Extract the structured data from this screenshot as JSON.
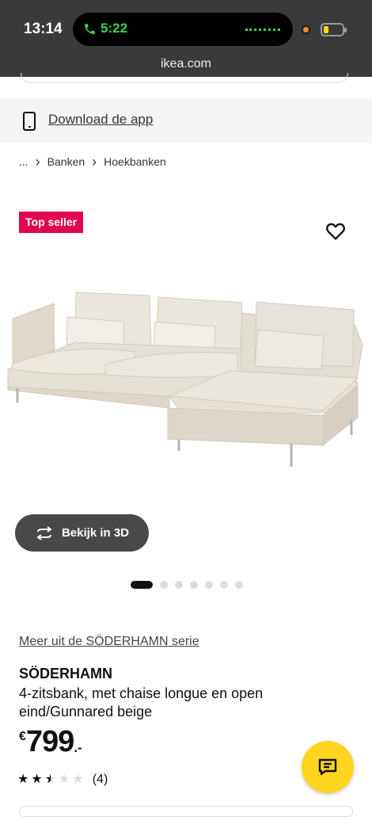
{
  "status_bar": {
    "time": "13:14",
    "call_timer": "5:22",
    "url": "ikea.com"
  },
  "app_banner": {
    "link_text": "Download de app",
    "icon": "phone-icon"
  },
  "breadcrumb": {
    "items": [
      "...",
      "Banken",
      "Hoekbanken"
    ]
  },
  "product": {
    "badge": "Top seller",
    "wishlist_icon": "heart-icon",
    "view_3d_label": "Bekijk in 3D",
    "carousel": {
      "total": 7,
      "active": 1
    },
    "series_link": "Meer uit de SÖDERHAMN serie",
    "name": "SÖDERHAMN",
    "description": "4-zitsbank, met chaise longue en open eind/Gunnared beige",
    "price": {
      "currency": "€",
      "amount": "799",
      "suffix": ".-"
    },
    "rating": {
      "value": 2.5,
      "max": 5,
      "count": "(4)"
    }
  },
  "colors": {
    "status_bar": "#3a3a3a",
    "badge": "#e00751",
    "chat_button": "#ffd520",
    "fabric": "#e6e1d7"
  },
  "chat_icon": "chat-icon"
}
